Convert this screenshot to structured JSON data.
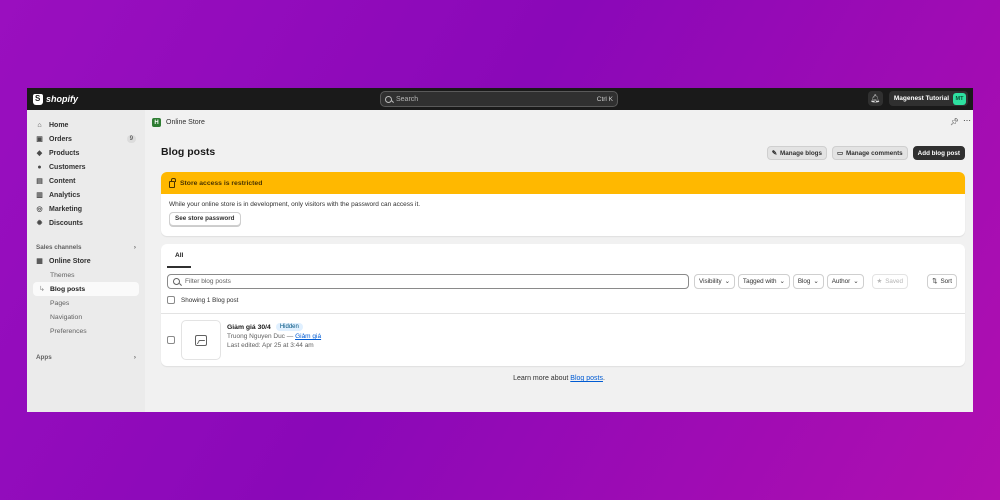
{
  "brand": {
    "name": "shopify"
  },
  "search": {
    "placeholder": "Search",
    "shortcut": "Ctrl K"
  },
  "user": {
    "store_name": "Magenest Tutorial",
    "initials": "MT"
  },
  "sidebar": {
    "items": [
      {
        "label": "Home",
        "icon": "home-icon"
      },
      {
        "label": "Orders",
        "icon": "inbox-icon",
        "badge": "9"
      },
      {
        "label": "Products",
        "icon": "tag-icon"
      },
      {
        "label": "Customers",
        "icon": "person-icon"
      },
      {
        "label": "Content",
        "icon": "content-icon"
      },
      {
        "label": "Analytics",
        "icon": "chart-icon"
      },
      {
        "label": "Marketing",
        "icon": "target-icon"
      },
      {
        "label": "Discounts",
        "icon": "discount-icon"
      }
    ],
    "sales_channels_title": "Sales channels",
    "online_store": "Online Store",
    "sub_items": [
      "Themes",
      "Blog posts",
      "Pages",
      "Navigation",
      "Preferences"
    ],
    "apps_title": "Apps"
  },
  "breadcrumb": {
    "label": "Online Store"
  },
  "page": {
    "title": "Blog posts",
    "actions": {
      "manage_blogs": "Manage blogs",
      "manage_comments": "Manage comments",
      "add_post": "Add blog post"
    }
  },
  "banner": {
    "title": "Store access is restricted",
    "message": "While your online store is in development, only visitors with the password can access it.",
    "button": "See store password",
    "color": "#ffb800"
  },
  "list": {
    "tab": "All",
    "filter_placeholder": "Filter blog posts",
    "filters": [
      "Visibility",
      "Tagged with",
      "Blog",
      "Author"
    ],
    "saved": "Saved",
    "sort": "Sort",
    "showing": "Showing 1 Blog post",
    "posts": [
      {
        "title": "Giảm giá 30/4",
        "status": "Hidden",
        "author": "Truong Nguyen Duc —",
        "blog": "Giảm giá",
        "edited": "Last edited: Apr 25 at 3:44 am"
      }
    ]
  },
  "footer": {
    "prefix": "Learn more about",
    "link": "Blog posts",
    "suffix": "."
  }
}
